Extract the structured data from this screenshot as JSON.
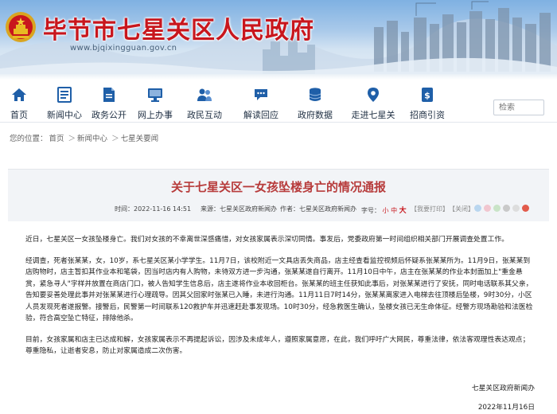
{
  "header": {
    "site_title": "毕节市七星关区人民政府",
    "site_domain": "www.bjqixingguan.gov.cn"
  },
  "nav": {
    "items": [
      {
        "label": "首页",
        "icon": "home-icon"
      },
      {
        "label": "新闻中心",
        "icon": "news-icon"
      },
      {
        "label": "政务公开",
        "icon": "document-icon"
      },
      {
        "label": "网上办事",
        "icon": "computer-icon"
      },
      {
        "label": "政民互动",
        "icon": "people-icon"
      },
      {
        "label": "解读回应",
        "icon": "chat-icon"
      },
      {
        "label": "政府数据",
        "icon": "database-icon"
      },
      {
        "label": "走进七星关",
        "icon": "location-icon"
      },
      {
        "label": "招商引资",
        "icon": "money-icon"
      }
    ],
    "search_placeholder": "检索"
  },
  "breadcrumb": {
    "prefix": "您的位置：",
    "items": [
      "首页",
      "新闻中心",
      "七星关要闻"
    ],
    "separator": "＞"
  },
  "article": {
    "title": "关于七星关区一女孩坠楼身亡的情况通报",
    "time": "时间：2022-11-16 14:51",
    "source": "来源：七星关区政府新闻办",
    "author": "作者：七星关区政府新闻办",
    "size_label": "字号：",
    "size_small": "小",
    "size_medium": "中",
    "size_large": "大",
    "print": "【我要打印】",
    "close": "【关闭】",
    "paragraphs": [
      "近日，七星关区一女孩坠楼身亡。我们对女孩的不幸离世深感痛惜，对女孩家属表示深切同情。事发后，党委政府第一时间组织相关部门开展调查处置工作。",
      "经调查，死者张某某，女，10岁，系七星关区某小学学生。11月7日，该校附近一文具店丢失商品，店主经查看监控视频后怀疑系张某某所为。11月9日，张某某到店购物时，店主暂扣其作业本和笔袋，因当时店内有人购物，未待双方进一步沟通，张某某遂自行离开。11月10日中午，店主在张某某的作业本封面加上\"重金悬赏，紧急寻人\"字样并放置在商店门口，被人告知学生信息后，店主遂将作业本收回柜台。张某某的班主任获知此事后，对张某某进行了安抚，同时电话联系其父亲，告知要妥善处理此事并对张某某进行心理疏导。因其父回家时张某已入睡，未进行沟通。11月11日7时14分，张某某离家进入电梯去往顶楼后坠楼，9时30分，小区人员发现死者遂报警。接警后，民警第一时间联系120救护车并迅速赶赴事发现场。10时30分，经急救医生确认，坠楼女孩已无生命体征。经警方现场勘验和法医检验，符合高空坠亡特征，排除他杀。",
      "目前，女孩家属和店主已达成和解，女孩家属表示不再提起诉讼，因涉及未成年人，遵照家属意愿，在此，我们呼吁广大网民，尊重法律，依法客观理性表达观点；尊重隐私，让逝者安息，防止对家属造成二次伤害。"
    ],
    "signature": "七星关区政府新闻办",
    "date": "2022年11月16日"
  },
  "colors": {
    "title_red": "#c8161d",
    "article_title": "#b73b3b",
    "nav_icon_blue": "#1f5fa8"
  }
}
